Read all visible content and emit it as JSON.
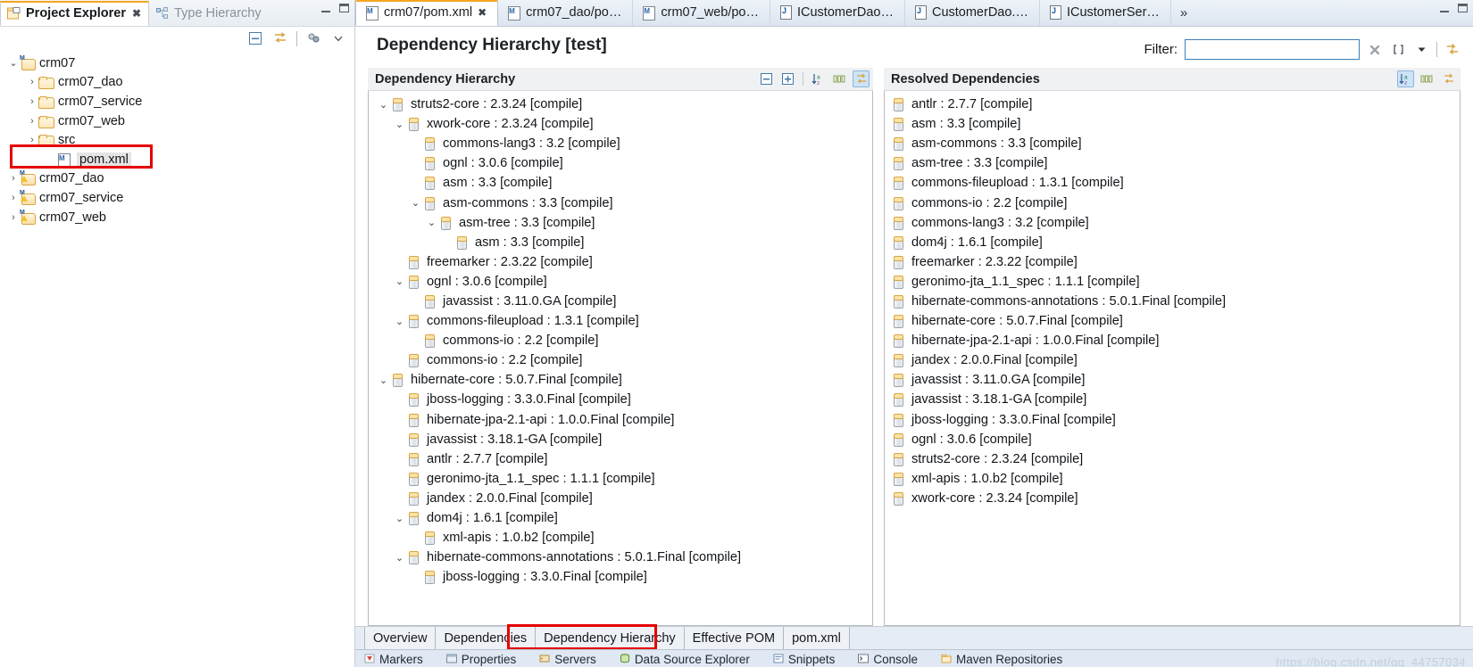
{
  "left_view": {
    "tabs": [
      {
        "label": "Project Explorer",
        "icon": "project-explorer-icon",
        "active": true,
        "close": "✖"
      },
      {
        "label": "Type Hierarchy",
        "icon": "type-hierarchy-icon",
        "active": false
      }
    ],
    "toolbar": [
      {
        "name": "collapse-all-icon",
        "glyph": "⊟"
      },
      {
        "name": "link-with-editor-icon",
        "glyph": "⇆"
      },
      {
        "name": "view-menu-icon",
        "glyph": "▽"
      }
    ],
    "tree": [
      {
        "indent": 0,
        "twisty": "⌄",
        "icon": "maven-project-icon",
        "label": "crm07",
        "selected": false
      },
      {
        "indent": 1,
        "twisty": "›",
        "icon": "folder-icon",
        "label": "crm07_dao",
        "selected": false
      },
      {
        "indent": 1,
        "twisty": "›",
        "icon": "folder-icon",
        "label": "crm07_service",
        "selected": false
      },
      {
        "indent": 1,
        "twisty": "›",
        "icon": "folder-icon",
        "label": "crm07_web",
        "selected": false
      },
      {
        "indent": 1,
        "twisty": "›",
        "icon": "folder-icon",
        "label": "src",
        "selected": false
      },
      {
        "indent": 2,
        "twisty": "",
        "icon": "pom-xml-icon",
        "label": "pom.xml",
        "selected": true
      },
      {
        "indent": 0,
        "twisty": "›",
        "icon": "maven-project-warning-icon",
        "label": "crm07_dao",
        "selected": false
      },
      {
        "indent": 0,
        "twisty": "›",
        "icon": "maven-project-warning-icon",
        "label": "crm07_service",
        "selected": false
      },
      {
        "indent": 0,
        "twisty": "›",
        "icon": "maven-project-warning-icon",
        "label": "crm07_web",
        "selected": false
      }
    ]
  },
  "editor": {
    "tabs": [
      {
        "label": "crm07/pom.xml",
        "icon": "pom-xml-icon",
        "active": true,
        "close": "✖"
      },
      {
        "label": "crm07_dao/po…",
        "icon": "pom-xml-icon",
        "active": false
      },
      {
        "label": "crm07_web/po…",
        "icon": "pom-xml-icon",
        "active": false
      },
      {
        "label": "ICustomerDao…",
        "icon": "java-file-icon",
        "active": false
      },
      {
        "label": "CustomerDao.…",
        "icon": "java-file-icon",
        "active": false
      },
      {
        "label": "ICustomerSer…",
        "icon": "java-file-icon",
        "active": false
      }
    ],
    "more_tabs_glyph": "»",
    "window_controls": [
      {
        "name": "minimize-button"
      },
      {
        "name": "maximize-button"
      }
    ],
    "form_title": "Dependency Hierarchy [test]",
    "filter": {
      "label": "Filter:",
      "value": "",
      "placeholder": "",
      "clear_icon": "✖",
      "brackets_icon": "[ ]",
      "dropdown_icon": "▼",
      "refresh_icon": "↻"
    }
  },
  "hierarchy_panel": {
    "title": "Dependency Hierarchy",
    "tools": [
      {
        "name": "collapse-all-icon",
        "glyph": "⊟",
        "active": false
      },
      {
        "name": "expand-all-icon",
        "glyph": "⊞",
        "active": false
      },
      {
        "name": "sort-icon",
        "glyph": "↓",
        "active": false
      },
      {
        "name": "columns-icon",
        "glyph": "‖",
        "active": false
      },
      {
        "name": "link-icon",
        "glyph": "⇥",
        "active": true
      }
    ],
    "tree": [
      {
        "indent": 0,
        "twisty": "⌄",
        "label": "struts2-core : 2.3.24 [compile]"
      },
      {
        "indent": 1,
        "twisty": "⌄",
        "label": "xwork-core : 2.3.24 [compile]"
      },
      {
        "indent": 2,
        "twisty": "",
        "label": "commons-lang3 : 3.2 [compile]"
      },
      {
        "indent": 2,
        "twisty": "",
        "label": "ognl : 3.0.6 [compile]"
      },
      {
        "indent": 2,
        "twisty": "",
        "label": "asm : 3.3 [compile]"
      },
      {
        "indent": 2,
        "twisty": "⌄",
        "label": "asm-commons : 3.3 [compile]"
      },
      {
        "indent": 3,
        "twisty": "⌄",
        "label": "asm-tree : 3.3 [compile]"
      },
      {
        "indent": 4,
        "twisty": "",
        "label": "asm : 3.3 [compile]"
      },
      {
        "indent": 1,
        "twisty": "",
        "label": "freemarker : 2.3.22 [compile]"
      },
      {
        "indent": 1,
        "twisty": "⌄",
        "label": "ognl : 3.0.6 [compile]"
      },
      {
        "indent": 2,
        "twisty": "",
        "label": "javassist : 3.11.0.GA [compile]"
      },
      {
        "indent": 1,
        "twisty": "⌄",
        "label": "commons-fileupload : 1.3.1 [compile]"
      },
      {
        "indent": 2,
        "twisty": "",
        "label": "commons-io : 2.2 [compile]"
      },
      {
        "indent": 1,
        "twisty": "",
        "label": "commons-io : 2.2 [compile]"
      },
      {
        "indent": 0,
        "twisty": "⌄",
        "label": "hibernate-core : 5.0.7.Final [compile]"
      },
      {
        "indent": 1,
        "twisty": "",
        "label": "jboss-logging : 3.3.0.Final [compile]"
      },
      {
        "indent": 1,
        "twisty": "",
        "label": "hibernate-jpa-2.1-api : 1.0.0.Final [compile]"
      },
      {
        "indent": 1,
        "twisty": "",
        "label": "javassist : 3.18.1-GA [compile]"
      },
      {
        "indent": 1,
        "twisty": "",
        "label": "antlr : 2.7.7 [compile]"
      },
      {
        "indent": 1,
        "twisty": "",
        "label": "geronimo-jta_1.1_spec : 1.1.1 [compile]"
      },
      {
        "indent": 1,
        "twisty": "",
        "label": "jandex : 2.0.0.Final [compile]"
      },
      {
        "indent": 1,
        "twisty": "⌄",
        "label": "dom4j : 1.6.1 [compile]"
      },
      {
        "indent": 2,
        "twisty": "",
        "label": "xml-apis : 1.0.b2 [compile]"
      },
      {
        "indent": 1,
        "twisty": "⌄",
        "label": "hibernate-commons-annotations : 5.0.1.Final [compile]"
      },
      {
        "indent": 2,
        "twisty": "",
        "label": "jboss-logging : 3.3.0.Final [compile]"
      }
    ]
  },
  "resolved_panel": {
    "title": "Resolved Dependencies",
    "tools": [
      {
        "name": "sort-icon",
        "glyph": "↓",
        "active": true
      },
      {
        "name": "columns-icon",
        "glyph": "‖",
        "active": false
      },
      {
        "name": "link-icon",
        "glyph": "⇥",
        "active": false
      }
    ],
    "items": [
      "antlr : 2.7.7 [compile]",
      "asm : 3.3 [compile]",
      "asm-commons : 3.3 [compile]",
      "asm-tree : 3.3 [compile]",
      "commons-fileupload : 1.3.1 [compile]",
      "commons-io : 2.2 [compile]",
      "commons-lang3 : 3.2 [compile]",
      "dom4j : 1.6.1 [compile]",
      "freemarker : 2.3.22 [compile]",
      "geronimo-jta_1.1_spec : 1.1.1 [compile]",
      "hibernate-commons-annotations : 5.0.1.Final [compile]",
      "hibernate-core : 5.0.7.Final [compile]",
      "hibernate-jpa-2.1-api : 1.0.0.Final [compile]",
      "jandex : 2.0.0.Final [compile]",
      "javassist : 3.11.0.GA [compile]",
      "javassist : 3.18.1-GA [compile]",
      "jboss-logging : 3.3.0.Final [compile]",
      "ognl : 3.0.6 [compile]",
      "struts2-core : 2.3.24 [compile]",
      "xml-apis : 1.0.b2 [compile]",
      "xwork-core : 2.3.24 [compile]"
    ]
  },
  "bottom_tabs": [
    {
      "label": "Overview",
      "active": false
    },
    {
      "label": "Dependencies",
      "active": false
    },
    {
      "label": "Dependency Hierarchy",
      "active": true
    },
    {
      "label": "Effective POM",
      "active": false
    },
    {
      "label": "pom.xml",
      "active": false
    }
  ],
  "views_strip": [
    {
      "label": "Markers",
      "icon": "markers-icon"
    },
    {
      "label": "Properties",
      "icon": "properties-icon"
    },
    {
      "label": "Servers",
      "icon": "servers-icon"
    },
    {
      "label": "Data Source Explorer",
      "icon": "data-source-icon"
    },
    {
      "label": "Snippets",
      "icon": "snippets-icon"
    },
    {
      "label": "Console",
      "icon": "console-icon"
    },
    {
      "label": "Maven Repositories",
      "icon": "maven-repo-icon"
    }
  ],
  "watermark": "https://blog.csdn.net/qq_44757034",
  "colors": {
    "accent": "#f5a623",
    "selection": "#cde4f7",
    "highlight_box": "#e60000",
    "jar_icon": "#d9a441"
  }
}
